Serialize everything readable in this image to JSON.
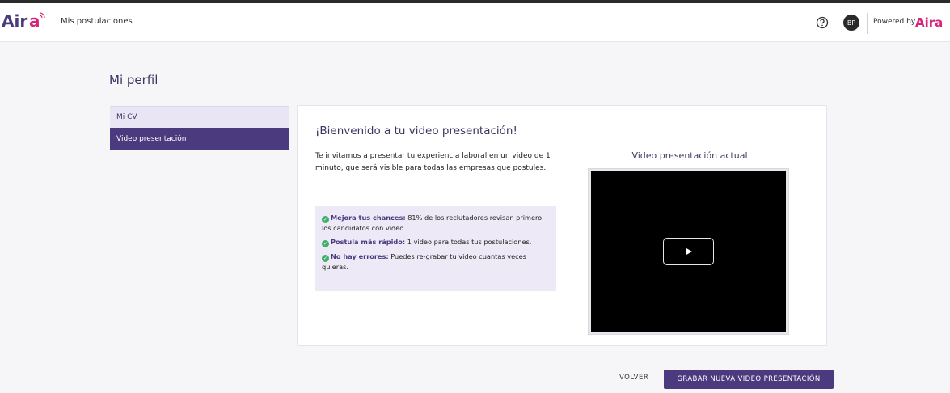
{
  "header": {
    "nav_link": "Mis postulaciones",
    "avatar_initials": "BP",
    "powered_by": "Powered by",
    "brand_logo_text": "Aira"
  },
  "page": {
    "title": "Mi perfil"
  },
  "sidebar": {
    "items": [
      {
        "label": "Mi CV",
        "active": false
      },
      {
        "label": "Video presentación",
        "active": true
      }
    ]
  },
  "card": {
    "title": "¡Bienvenido a tu video presentación!",
    "intro": "Te invitamos a presentar tu experiencia laboral en un video de 1 minuto, que será visible para todas las empresas que postules.",
    "benefits": [
      {
        "bold": "Mejora tus chances:",
        "text": " 81% de los reclutadores revisan primero los candidatos con video."
      },
      {
        "bold": "Postula más rápido:",
        "text": " 1 video para todas tus postulaciones."
      },
      {
        "bold": "No hay errores:",
        "text": " Puedes re-grabar tu video cuantas veces quieras."
      }
    ],
    "video_title": "Video presentación actual"
  },
  "actions": {
    "back_label": "VOLVER",
    "record_label": "GRABAR NUEVA VIDEO PRESENTACIÓN"
  },
  "colors": {
    "brand": "#4b3a7d",
    "accent_pink": "#d6247a",
    "check": "#3db16b"
  }
}
